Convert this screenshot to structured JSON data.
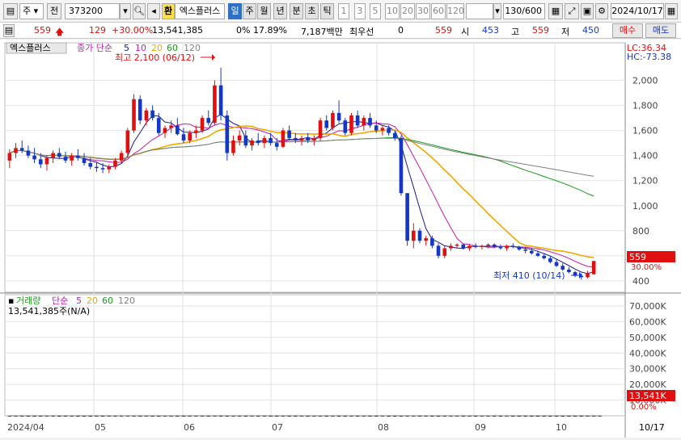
{
  "toolbar": {
    "menu_label": "주",
    "prev_label": "전",
    "code_value": "373200",
    "special_badge": "환",
    "stock_name": "엑스플러스",
    "period_tabs": [
      "일",
      "주",
      "월",
      "년",
      "분",
      "초",
      "틱"
    ],
    "active_period": "일",
    "intervals": [
      "1",
      "3",
      "5",
      "10",
      "20",
      "30",
      "60",
      "120"
    ],
    "count": "130/600",
    "date": "2024/10/17"
  },
  "quote": {
    "price": "559",
    "change": "129",
    "change_rate": "+30.00%",
    "volume": "13,541,385",
    "ratio": "0% 17.89%",
    "amount": "7,187백만",
    "priority_label": "최우선",
    "priority_value": "0",
    "bid": "559",
    "open_label": "시",
    "open": "453",
    "high_label": "고",
    "high": "559",
    "low_label": "저",
    "low": "450",
    "buy_label": "매수",
    "sell_label": "매도"
  },
  "price_panel": {
    "name_badge": "엑스플러스",
    "legend_prefix": "종가 단순",
    "ma_periods": [
      "5",
      "10",
      "20",
      "60",
      "120"
    ],
    "lc": "LC:36.34",
    "hc": "HC:-73.38",
    "high_note": "최고 2,100 (06/12)",
    "low_note": "최저 410 (10/14)",
    "last_price": "559",
    "last_pct": "30.00%",
    "y_ticks": [
      "2,000",
      "1,800",
      "1,600",
      "1,400",
      "1,200",
      "1,000",
      "800",
      "600",
      "400"
    ]
  },
  "volume_panel": {
    "title": "거래량",
    "legend_prefix": "단순",
    "ma_periods": [
      "5",
      "20",
      "60",
      "120"
    ],
    "volume_text": "13,541,385주(N/A)",
    "last_volume": "13,541K",
    "last_pct": "0.00%",
    "y_ticks": [
      "70,000K",
      "60,000K",
      "50,000K",
      "40,000K",
      "30,000K",
      "20,000K",
      "10,000K"
    ]
  },
  "x_axis": {
    "labels": [
      "2024/04",
      "05",
      "06",
      "07",
      "08",
      "09",
      "10"
    ],
    "right_label": "10/17"
  },
  "colors": {
    "up": "#e01010",
    "down": "#1437c8",
    "ma5": "#1a1a8c",
    "ma10": "#c01cb0",
    "ma20": "#f0a800",
    "ma60": "#1a9a1a",
    "ma120": "#808080"
  },
  "chart_data": {
    "type": "candlestick",
    "y_range": [
      400,
      2100
    ],
    "volume_range": [
      0,
      70000
    ],
    "candles": [
      {
        "o": 1360,
        "h": 1450,
        "l": 1300,
        "c": 1420
      },
      {
        "o": 1420,
        "h": 1500,
        "l": 1380,
        "c": 1460
      },
      {
        "o": 1460,
        "h": 1520,
        "l": 1420,
        "c": 1440
      },
      {
        "o": 1440,
        "h": 1480,
        "l": 1380,
        "c": 1400
      },
      {
        "o": 1400,
        "h": 1460,
        "l": 1340,
        "c": 1370
      },
      {
        "o": 1370,
        "h": 1420,
        "l": 1300,
        "c": 1330
      },
      {
        "o": 1330,
        "h": 1400,
        "l": 1280,
        "c": 1380
      },
      {
        "o": 1380,
        "h": 1440,
        "l": 1340,
        "c": 1420
      },
      {
        "o": 1420,
        "h": 1460,
        "l": 1370,
        "c": 1390
      },
      {
        "o": 1390,
        "h": 1430,
        "l": 1340,
        "c": 1360
      },
      {
        "o": 1360,
        "h": 1420,
        "l": 1320,
        "c": 1400
      },
      {
        "o": 1400,
        "h": 1450,
        "l": 1360,
        "c": 1380
      },
      {
        "o": 1380,
        "h": 1420,
        "l": 1320,
        "c": 1340
      },
      {
        "o": 1340,
        "h": 1380,
        "l": 1290,
        "c": 1310
      },
      {
        "o": 1310,
        "h": 1350,
        "l": 1270,
        "c": 1300
      },
      {
        "o": 1300,
        "h": 1340,
        "l": 1260,
        "c": 1290
      },
      {
        "o": 1290,
        "h": 1330,
        "l": 1260,
        "c": 1310
      },
      {
        "o": 1310,
        "h": 1380,
        "l": 1290,
        "c": 1360
      },
      {
        "o": 1360,
        "h": 1440,
        "l": 1340,
        "c": 1420
      },
      {
        "o": 1420,
        "h": 1620,
        "l": 1400,
        "c": 1600
      },
      {
        "o": 1600,
        "h": 1890,
        "l": 1580,
        "c": 1850
      },
      {
        "o": 1850,
        "h": 1880,
        "l": 1650,
        "c": 1680
      },
      {
        "o": 1680,
        "h": 1780,
        "l": 1640,
        "c": 1760
      },
      {
        "o": 1760,
        "h": 1800,
        "l": 1680,
        "c": 1700
      },
      {
        "o": 1700,
        "h": 1740,
        "l": 1560,
        "c": 1580
      },
      {
        "o": 1580,
        "h": 1640,
        "l": 1540,
        "c": 1620
      },
      {
        "o": 1620,
        "h": 1680,
        "l": 1580,
        "c": 1640
      },
      {
        "o": 1640,
        "h": 1700,
        "l": 1560,
        "c": 1570
      },
      {
        "o": 1570,
        "h": 1620,
        "l": 1500,
        "c": 1520
      },
      {
        "o": 1520,
        "h": 1600,
        "l": 1500,
        "c": 1580
      },
      {
        "o": 1580,
        "h": 1640,
        "l": 1540,
        "c": 1600
      },
      {
        "o": 1600,
        "h": 1720,
        "l": 1580,
        "c": 1700
      },
      {
        "o": 1700,
        "h": 1760,
        "l": 1640,
        "c": 1660
      },
      {
        "o": 1660,
        "h": 2000,
        "l": 1640,
        "c": 1960
      },
      {
        "o": 1960,
        "h": 2100,
        "l": 1680,
        "c": 1720
      },
      {
        "o": 1720,
        "h": 1760,
        "l": 1360,
        "c": 1420
      },
      {
        "o": 1420,
        "h": 1560,
        "l": 1400,
        "c": 1520
      },
      {
        "o": 1520,
        "h": 1600,
        "l": 1480,
        "c": 1560
      },
      {
        "o": 1560,
        "h": 1600,
        "l": 1460,
        "c": 1480
      },
      {
        "o": 1480,
        "h": 1540,
        "l": 1440,
        "c": 1520
      },
      {
        "o": 1520,
        "h": 1580,
        "l": 1480,
        "c": 1500
      },
      {
        "o": 1500,
        "h": 1560,
        "l": 1460,
        "c": 1540
      },
      {
        "o": 1540,
        "h": 1580,
        "l": 1480,
        "c": 1500
      },
      {
        "o": 1500,
        "h": 1540,
        "l": 1440,
        "c": 1470
      },
      {
        "o": 1470,
        "h": 1620,
        "l": 1460,
        "c": 1600
      },
      {
        "o": 1600,
        "h": 1640,
        "l": 1520,
        "c": 1540
      },
      {
        "o": 1540,
        "h": 1580,
        "l": 1500,
        "c": 1520
      },
      {
        "o": 1520,
        "h": 1560,
        "l": 1480,
        "c": 1540
      },
      {
        "o": 1540,
        "h": 1580,
        "l": 1500,
        "c": 1520
      },
      {
        "o": 1520,
        "h": 1560,
        "l": 1480,
        "c": 1540
      },
      {
        "o": 1540,
        "h": 1700,
        "l": 1520,
        "c": 1680
      },
      {
        "o": 1680,
        "h": 1720,
        "l": 1600,
        "c": 1620
      },
      {
        "o": 1620,
        "h": 1760,
        "l": 1600,
        "c": 1740
      },
      {
        "o": 1740,
        "h": 1840,
        "l": 1660,
        "c": 1680
      },
      {
        "o": 1680,
        "h": 1700,
        "l": 1560,
        "c": 1580
      },
      {
        "o": 1580,
        "h": 1740,
        "l": 1560,
        "c": 1720
      },
      {
        "o": 1720,
        "h": 1760,
        "l": 1620,
        "c": 1640
      },
      {
        "o": 1640,
        "h": 1720,
        "l": 1600,
        "c": 1700
      },
      {
        "o": 1700,
        "h": 1740,
        "l": 1620,
        "c": 1640
      },
      {
        "o": 1640,
        "h": 1680,
        "l": 1580,
        "c": 1600
      },
      {
        "o": 1600,
        "h": 1640,
        "l": 1560,
        "c": 1620
      },
      {
        "o": 1620,
        "h": 1640,
        "l": 1560,
        "c": 1580
      },
      {
        "o": 1580,
        "h": 1600,
        "l": 1520,
        "c": 1540
      },
      {
        "o": 1540,
        "h": 1560,
        "l": 1080,
        "c": 1100
      },
      {
        "o": 1100,
        "h": 900,
        "l": 680,
        "c": 720
      },
      {
        "o": 720,
        "h": 860,
        "l": 660,
        "c": 800
      },
      {
        "o": 800,
        "h": 820,
        "l": 700,
        "c": 720
      },
      {
        "o": 720,
        "h": 760,
        "l": 680,
        "c": 740
      },
      {
        "o": 740,
        "h": 760,
        "l": 660,
        "c": 680
      },
      {
        "o": 680,
        "h": 700,
        "l": 580,
        "c": 600
      },
      {
        "o": 600,
        "h": 680,
        "l": 580,
        "c": 660
      },
      {
        "o": 660,
        "h": 700,
        "l": 640,
        "c": 680
      },
      {
        "o": 680,
        "h": 700,
        "l": 660,
        "c": 690
      },
      {
        "o": 690,
        "h": 700,
        "l": 650,
        "c": 660
      },
      {
        "o": 660,
        "h": 690,
        "l": 640,
        "c": 680
      },
      {
        "o": 680,
        "h": 700,
        "l": 660,
        "c": 670
      },
      {
        "o": 670,
        "h": 690,
        "l": 650,
        "c": 680
      },
      {
        "o": 680,
        "h": 700,
        "l": 660,
        "c": 690
      },
      {
        "o": 690,
        "h": 700,
        "l": 660,
        "c": 670
      },
      {
        "o": 670,
        "h": 690,
        "l": 650,
        "c": 660
      },
      {
        "o": 660,
        "h": 690,
        "l": 640,
        "c": 680
      },
      {
        "o": 680,
        "h": 700,
        "l": 660,
        "c": 670
      },
      {
        "o": 670,
        "h": 680,
        "l": 640,
        "c": 650
      },
      {
        "o": 650,
        "h": 670,
        "l": 620,
        "c": 640
      },
      {
        "o": 640,
        "h": 660,
        "l": 610,
        "c": 620
      },
      {
        "o": 620,
        "h": 640,
        "l": 590,
        "c": 600
      },
      {
        "o": 600,
        "h": 620,
        "l": 570,
        "c": 580
      },
      {
        "o": 580,
        "h": 600,
        "l": 540,
        "c": 550
      },
      {
        "o": 550,
        "h": 570,
        "l": 510,
        "c": 520
      },
      {
        "o": 520,
        "h": 540,
        "l": 480,
        "c": 490
      },
      {
        "o": 490,
        "h": 510,
        "l": 460,
        "c": 470
      },
      {
        "o": 470,
        "h": 480,
        "l": 430,
        "c": 440
      },
      {
        "o": 440,
        "h": 460,
        "l": 410,
        "c": 430
      },
      {
        "o": 430,
        "h": 480,
        "l": 420,
        "c": 460
      },
      {
        "o": 453,
        "h": 559,
        "l": 450,
        "c": 559
      }
    ],
    "volumes": [
      3,
      4,
      3,
      3,
      2,
      3,
      3,
      3,
      2,
      2,
      3,
      2,
      2,
      3,
      2,
      2,
      3,
      3,
      4,
      14,
      20,
      9,
      6,
      5,
      4,
      4,
      3,
      3,
      3,
      3,
      4,
      5,
      4,
      12,
      18,
      8,
      5,
      4,
      3,
      3,
      3,
      3,
      3,
      3,
      4,
      3,
      3,
      3,
      3,
      3,
      6,
      4,
      5,
      5,
      4,
      5,
      3,
      3,
      3,
      3,
      3,
      3,
      3,
      14,
      68,
      6,
      4,
      3,
      3,
      3,
      3,
      3,
      2,
      2,
      2,
      2,
      2,
      2,
      2,
      2,
      2,
      2,
      2,
      2,
      2,
      2,
      2,
      2,
      2,
      2,
      2,
      2,
      2,
      3,
      3,
      13
    ]
  }
}
